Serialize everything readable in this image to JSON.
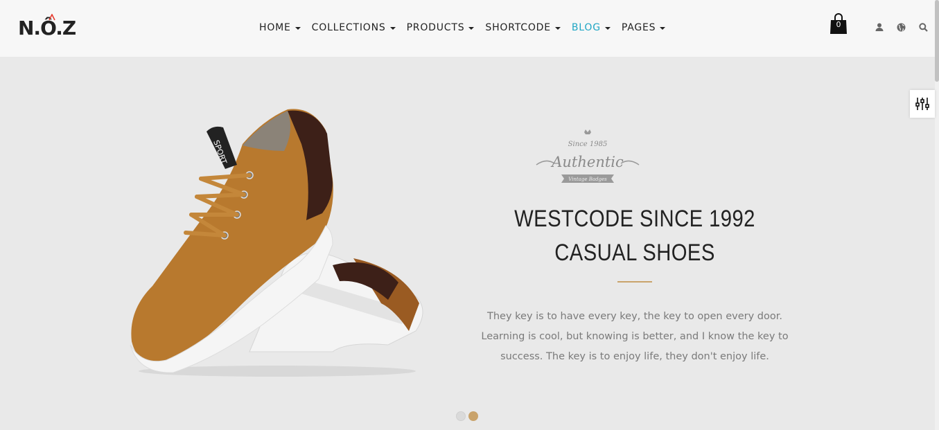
{
  "brand": {
    "logo_text": "N.Ô.Z",
    "accent": "#20a6c4",
    "gold": "#c9a36b"
  },
  "nav": {
    "items": [
      {
        "label": "HOME",
        "active": false
      },
      {
        "label": "COLLECTIONS",
        "active": false
      },
      {
        "label": "PRODUCTS",
        "active": false
      },
      {
        "label": "SHORTCODE",
        "active": false
      },
      {
        "label": "BLOG",
        "active": true
      },
      {
        "label": "PAGES",
        "active": false
      }
    ]
  },
  "header_icons": {
    "cart_count": "0",
    "icons": [
      "shopping-bag-icon",
      "user-icon",
      "globe-icon",
      "search-icon"
    ]
  },
  "hero": {
    "badge": {
      "since": "Since 1985",
      "title": "Authentic",
      "ribbon": "Vintage Badges"
    },
    "headline_line1": "WESTCODE SINCE 1992",
    "headline_line2": "CASUAL SHOES",
    "description": "They key is to have every key, the key to open every door. Learning is cool, but knowing is better, and I know the key to success. The key is to enjoy life, they don't enjoy life.",
    "shoe_tab_text": "SPORT"
  },
  "slider": {
    "total_slides": 2,
    "active_slide": 2
  }
}
